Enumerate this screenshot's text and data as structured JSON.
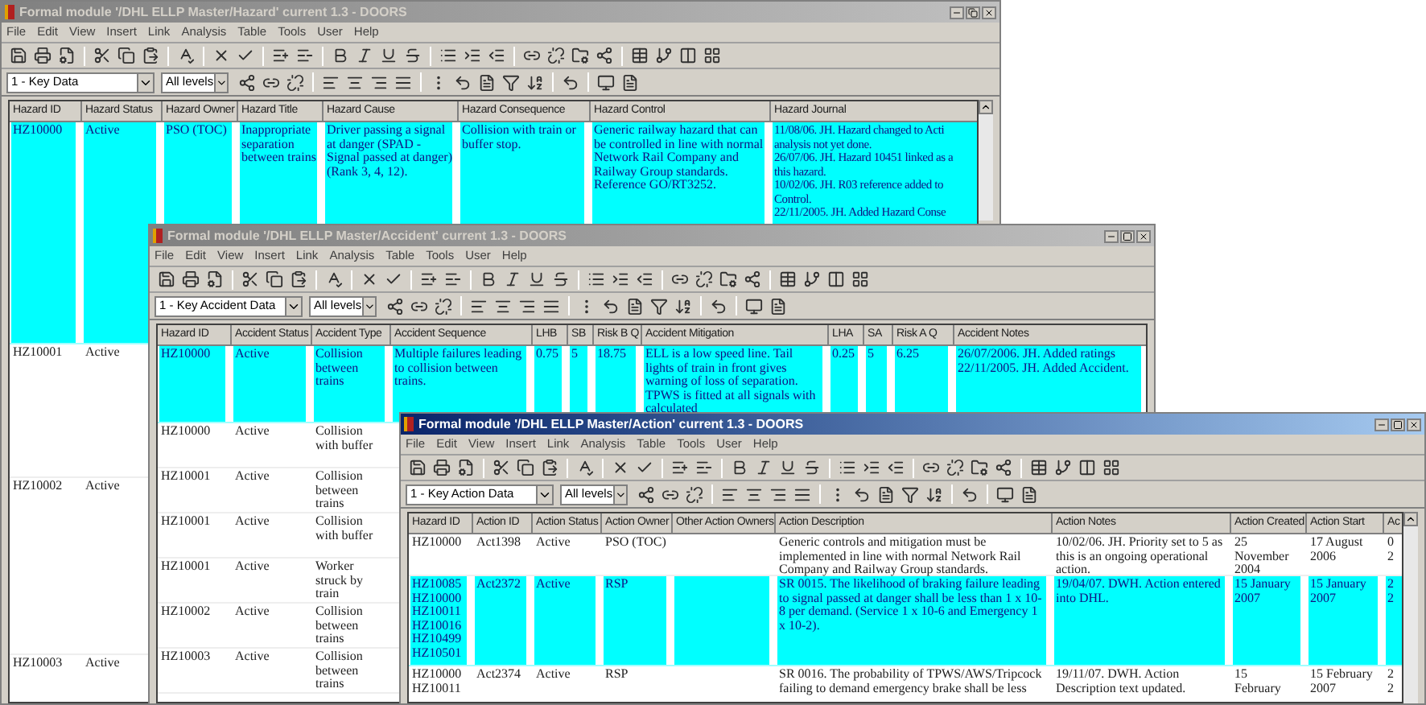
{
  "windows": [
    {
      "title": "Formal module '/DHL ELLP Master/Hazard' current 1.3 - DOORS",
      "active": false,
      "menu": [
        "File",
        "Edit",
        "View",
        "Insert",
        "Link",
        "Analysis",
        "Table",
        "Tools",
        "User",
        "Help"
      ],
      "view_select": "1 - Key Data",
      "level_select": "All levels",
      "columns": [
        "Hazard ID",
        "Hazard Status",
        "Hazard Owner",
        "Hazard Title",
        "Hazard Cause",
        "Hazard Consequence",
        "Hazard Control",
        "Hazard Journal"
      ],
      "rows": [
        {
          "selected": true,
          "cells": [
            "HZ10000",
            "Active",
            "PSO (TOC)",
            "Inappropriate separation between trains",
            "Driver passing a signal at danger (SPAD - Signal passed at danger) (Rank 3, 4, 12).",
            "Collision with train or buffer stop.",
            "Generic railway hazard that can be controlled in line with normal Network Rail Company and Railway Group standards. Reference GO/RT3252.",
            "11/08/06. JH. Hazard changed to Acti\nanalysis not yet done.\n26/07/06. JH. Hazard 10451 linked as a\nthis hazard.\n10/02/06. JH. R03 reference added to\nControl.\n22/11/2005. JH. Added Hazard Conse"
          ]
        },
        {
          "selected": false,
          "cells": [
            "HZ10001",
            "Active"
          ]
        },
        {
          "selected": false,
          "cells": [
            "HZ10002",
            "Active"
          ]
        },
        {
          "selected": false,
          "cells": [
            "HZ10003",
            "Active"
          ]
        }
      ]
    },
    {
      "title": "Formal module '/DHL ELLP Master/Accident' current 1.3 - DOORS",
      "active": false,
      "menu": [
        "File",
        "Edit",
        "View",
        "Insert",
        "Link",
        "Analysis",
        "Table",
        "Tools",
        "User",
        "Help"
      ],
      "view_select": "1 - Key Accident Data",
      "level_select": "All levels",
      "columns": [
        "Hazard ID",
        "Accident Status",
        "Accident Type",
        "Accident Sequence",
        "LHB",
        "SB",
        "Risk B Q",
        "Accident Mitigation",
        "LHA",
        "SA",
        "Risk A Q",
        "Accident Notes"
      ],
      "rows": [
        {
          "selected": true,
          "cells": [
            "HZ10000",
            "Active",
            "Collision between trains",
            "Multiple failures leading to collision between trains.",
            "0.75",
            "5",
            "18.75",
            "ELL is a low speed line. Tail lights of train in front gives warning of loss of separation. TPWS is fitted at all signals with calculated",
            "0.25",
            "5",
            "6.25",
            "26/07/2006. JH. Added ratings\n22/11/2005. JH. Added Accident."
          ]
        },
        {
          "selected": false,
          "cells": [
            "HZ10000",
            "Active",
            "Collision with buffer"
          ]
        },
        {
          "selected": false,
          "cells": [
            "HZ10001",
            "Active",
            "Collision between trains"
          ]
        },
        {
          "selected": false,
          "cells": [
            "HZ10001",
            "Active",
            "Collision with buffer"
          ]
        },
        {
          "selected": false,
          "cells": [
            "HZ10001",
            "Active",
            "Worker struck by train"
          ]
        },
        {
          "selected": false,
          "cells": [
            "HZ10002",
            "Active",
            "Collision between trains"
          ]
        },
        {
          "selected": false,
          "cells": [
            "HZ10003",
            "Active",
            "Collision between trains"
          ]
        }
      ]
    },
    {
      "title": "Formal module '/DHL ELLP Master/Action' current 1.3 - DOORS",
      "active": true,
      "menu": [
        "File",
        "Edit",
        "View",
        "Insert",
        "Link",
        "Analysis",
        "Table",
        "Tools",
        "User",
        "Help"
      ],
      "view_select": "1 - Key Action Data",
      "level_select": "All levels",
      "columns": [
        "Hazard ID",
        "Action ID",
        "Action Status",
        "Action Owner",
        "Other Action Owners",
        "Action Description",
        "Action Notes",
        "Action Created",
        "Action Start",
        "Ac"
      ],
      "rows": [
        {
          "selected": false,
          "cells": [
            "HZ10000",
            "Act1398",
            "Active",
            "PSO (TOC)",
            "",
            "Generic controls and mitigation must be implemented in line with normal Network Rail Company and Railway Group standards.",
            "10/02/06. JH. Priority set to 5 as this is an ongoing operational action.",
            "25 November 2004",
            "17 August 2006",
            "0\n2"
          ]
        },
        {
          "selected": true,
          "cells": [
            "HZ10085\nHZ10000\nHZ10011\nHZ10016\nHZ10499\nHZ10501",
            "Act2372",
            "Active",
            "RSP",
            "",
            "SR 0015. The likelihood of braking failure leading to signal passed at danger shall be less than 1 x 10-8 per demand. (Service 1 x 10-6 and Emergency 1 x 10-2).",
            "19/04/07. DWH. Action entered into DHL.",
            "15 January 2007",
            "15 January 2007",
            "2\n2"
          ]
        },
        {
          "selected": false,
          "cells": [
            "HZ10000\nHZ10011",
            "Act2374",
            "Active",
            "RSP",
            "",
            "SR 0016. The probability of TPWS/AWS/Tripcock\nfailing to demand emergency brake shall be less",
            "19/11/07. DWH. Action Description text updated.",
            "15\nFebruary",
            "15 February 2007",
            "2\n2"
          ]
        }
      ]
    }
  ]
}
